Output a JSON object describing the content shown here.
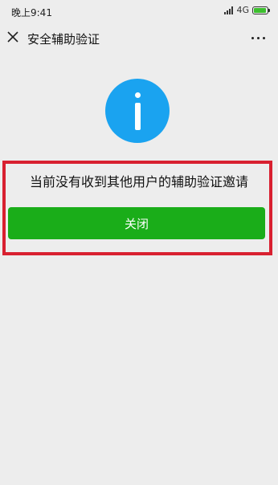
{
  "status_bar": {
    "time": "晚上9:41",
    "network": "4G",
    "battery_icon": "battery-icon",
    "signal_icon": "signal-icon"
  },
  "nav": {
    "title": "安全辅助验证",
    "close_icon": "close-icon",
    "more_icon": "more-icon"
  },
  "main": {
    "info_icon": "info-icon",
    "message": "当前没有收到其他用户的辅助验证邀请",
    "close_button_label": "关闭"
  },
  "colors": {
    "accent_green": "#1aad19",
    "info_blue": "#1aa3f0",
    "highlight_red": "#d82030",
    "background": "#ededed"
  }
}
